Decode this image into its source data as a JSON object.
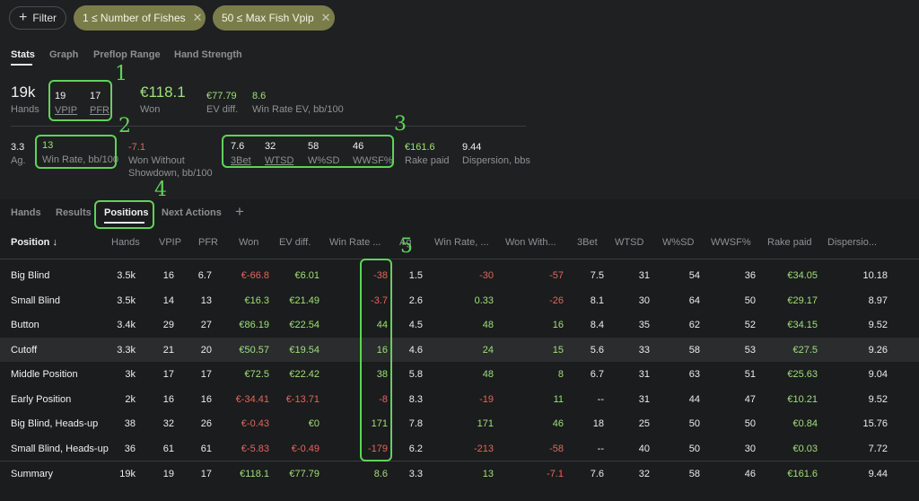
{
  "filters": {
    "filter_label": "Filter",
    "chips": [
      "1 ≤ Number of Fishes",
      "50 ≤ Max Fish Vpip"
    ]
  },
  "stat_tabs": [
    "Stats",
    "Graph",
    "Preflop Range",
    "Hand Strength"
  ],
  "stats": {
    "hands_value": "19k",
    "hands_label": "Hands",
    "vpip_value": "19",
    "vpip_label": "VPIP",
    "pfr_value": "17",
    "pfr_label": "PFR",
    "won_value": "€118.1",
    "won_label": "Won",
    "ev_value": "€77.79",
    "ev_label": "EV diff.",
    "wrev_value": "8.6",
    "wrev_label": "Win Rate EV, bb/100",
    "ag_value": "3.3",
    "ag_label": "Ag.",
    "winrate_value": "13",
    "winrate_label": "Win Rate, bb/100",
    "wws_value": "-7.1",
    "wws_label_1": "Won Without",
    "wws_label_2": "Showdown, bb/100",
    "threebet_value": "7.6",
    "threebet_label": "3Bet",
    "wtsd_value": "32",
    "wtsd_label": "WTSD",
    "wsd_value": "58",
    "wsd_label": "W%SD",
    "wwsf_value": "46",
    "wwsf_label": "WWSF%",
    "rake_value": "€161.6",
    "rake_label": "Rake paid",
    "disp_value": "9.44",
    "disp_label": "Dispersion, bbs"
  },
  "annotations": [
    "1",
    "2",
    "3",
    "4",
    "5"
  ],
  "table_tabs": [
    "Hands",
    "Results",
    "Positions",
    "Next Actions"
  ],
  "add_tab": "+",
  "columns": [
    "Position ↓",
    "Hands",
    "VPIP",
    "PFR",
    "Won",
    "EV diff.",
    "Win Rate ...",
    "Ag",
    "Win Rate, ...",
    "Won With...",
    "3Bet",
    "WTSD",
    "W%SD",
    "WWSF%",
    "Rake paid",
    "Dispersio..."
  ],
  "rows": [
    [
      "Big Blind",
      "3.5k",
      "16",
      "6.7",
      "€-66.8",
      "€6.01",
      "-38",
      "1.5",
      "-30",
      "-57",
      "7.5",
      "31",
      "54",
      "36",
      "€34.05",
      "10.18"
    ],
    [
      "Small Blind",
      "3.5k",
      "14",
      "13",
      "€16.3",
      "€21.49",
      "-3.7",
      "2.6",
      "0.33",
      "-26",
      "8.1",
      "30",
      "64",
      "50",
      "€29.17",
      "8.97"
    ],
    [
      "Button",
      "3.4k",
      "29",
      "27",
      "€86.19",
      "€22.54",
      "44",
      "4.5",
      "48",
      "16",
      "8.4",
      "35",
      "62",
      "52",
      "€34.15",
      "9.52"
    ],
    [
      "Cutoff",
      "3.3k",
      "21",
      "20",
      "€50.57",
      "€19.54",
      "16",
      "4.6",
      "24",
      "15",
      "5.6",
      "33",
      "58",
      "53",
      "€27.5",
      "9.26"
    ],
    [
      "Middle Position",
      "3k",
      "17",
      "17",
      "€72.5",
      "€22.42",
      "38",
      "5.8",
      "48",
      "8",
      "6.7",
      "31",
      "63",
      "51",
      "€25.63",
      "9.04"
    ],
    [
      "Early Position",
      "2k",
      "16",
      "16",
      "€-34.41",
      "€-13.71",
      "-8",
      "8.3",
      "-19",
      "11",
      "--",
      "31",
      "44",
      "47",
      "€10.21",
      "9.52"
    ],
    [
      "Big Blind, Heads-up",
      "38",
      "32",
      "26",
      "€-0.43",
      "€0",
      "171",
      "7.8",
      "171",
      "46",
      "18",
      "25",
      "50",
      "50",
      "€0.84",
      "15.76"
    ],
    [
      "Small Blind, Heads-up",
      "36",
      "61",
      "61",
      "€-5.83",
      "€-0.49",
      "-179",
      "6.2",
      "-213",
      "-58",
      "--",
      "40",
      "50",
      "30",
      "€0.03",
      "7.72"
    ]
  ],
  "summary": [
    "Summary",
    "19k",
    "19",
    "17",
    "€118.1",
    "€77.79",
    "8.6",
    "3.3",
    "13",
    "-7.1",
    "7.6",
    "32",
    "58",
    "46",
    "€161.6",
    "9.44"
  ],
  "colors": {
    "positive": "#9fe07a",
    "negative": "#e0675d",
    "highlight": "#5fd35a",
    "chip": "#7a7d4a"
  }
}
